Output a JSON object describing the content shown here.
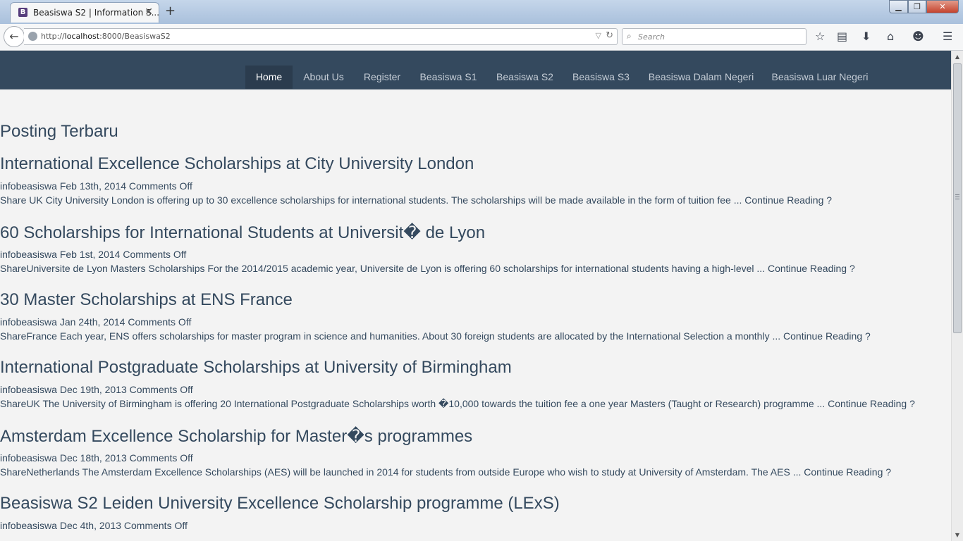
{
  "browser": {
    "tab_title": "Beasiswa S2 | Information S...",
    "tab_favicon_letter": "B",
    "tab_close": "✕",
    "new_tab": "+",
    "url_prefix": "http://",
    "url_host": "localhost",
    "url_path": ":8000/BeasiswaS2",
    "search_placeholder": "Search",
    "window_controls": {
      "minimize": "▁",
      "maximize": "❐",
      "close": "✕"
    },
    "toolbar_icons": [
      "bookmark-star-icon",
      "reading-list-icon",
      "download-icon",
      "home-icon",
      "emoji-icon",
      "hamburger-menu-icon"
    ]
  },
  "site": {
    "nav": [
      {
        "label": "Home",
        "active": true
      },
      {
        "label": "About Us",
        "active": false
      },
      {
        "label": "Register",
        "active": false
      },
      {
        "label": "Beasiswa S1",
        "active": false
      },
      {
        "label": "Beasiswa S2",
        "active": false
      },
      {
        "label": "Beasiswa S3",
        "active": false
      },
      {
        "label": "Beasiswa Dalam Negeri",
        "active": false
      },
      {
        "label": "Beasiswa Luar Negeri",
        "active": false
      }
    ],
    "colors": {
      "nav_bg": "#34495e",
      "nav_active_bg": "#2b3c4e",
      "text": "#34495e",
      "page_bg": "#f3f3f3"
    }
  },
  "main": {
    "section_title": "Posting Terbaru",
    "read_more": "Continue Reading ?",
    "posts": [
      {
        "title": "International Excellence Scholarships at City University London",
        "meta": "infobeasiswa Feb 13th, 2014 Comments Off",
        "excerpt": "Share UK City University London is offering up to 30 excellence scholarships for international students. The scholarships will be made available in the form of tuition fee ..."
      },
      {
        "title": "60 Scholarships for International Students at Universit� de Lyon",
        "meta": "infobeasiswa Feb 1st, 2014 Comments Off",
        "excerpt": "ShareUniversite de Lyon Masters Scholarships For the 2014/2015 academic year, Universite de Lyon is offering 60 scholarships for international students having a high-level ..."
      },
      {
        "title": "30 Master Scholarships at ENS France",
        "meta": "infobeasiswa Jan 24th, 2014 Comments Off",
        "excerpt": "ShareFrance Each year, ENS offers scholarships for master program in science and humanities. About 30 foreign students are allocated by the International Selection a monthly ..."
      },
      {
        "title": "International Postgraduate Scholarships at University of Birmingham",
        "meta": "infobeasiswa Dec 19th, 2013 Comments Off",
        "excerpt": "ShareUK The University of Birmingham is offering 20 International Postgraduate Scholarships worth �10,000 towards the tuition fee a one year Masters (Taught or Research) programme ..."
      },
      {
        "title": "Amsterdam Excellence Scholarship for Master�s programmes",
        "meta": "infobeasiswa Dec 18th, 2013 Comments Off",
        "excerpt": "ShareNetherlands The Amsterdam Excellence Scholarships (AES) will be launched in 2014 for students from outside Europe who wish to study at University of Amsterdam. The AES ..."
      },
      {
        "title": "Beasiswa S2 Leiden University Excellence Scholarship programme (LExS)",
        "meta": "infobeasiswa Dec 4th, 2013 Comments Off",
        "excerpt": ""
      }
    ]
  },
  "scrollbar": {
    "up": "▲",
    "down": "▼"
  }
}
